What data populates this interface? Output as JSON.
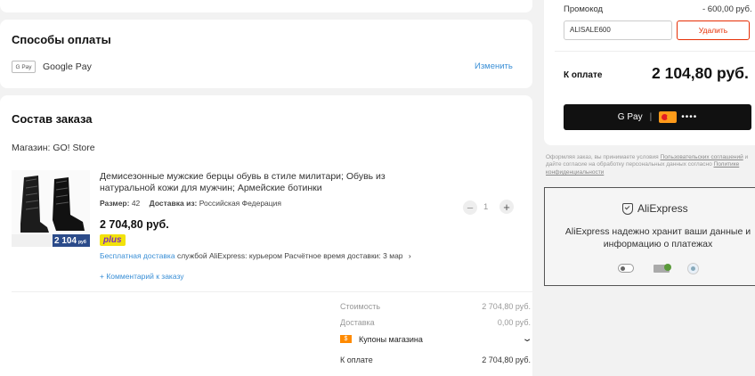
{
  "payment": {
    "title": "Способы оплаты",
    "method_badge": "G Pay",
    "method_name": "Google Pay",
    "change_label": "Изменить"
  },
  "order": {
    "title": "Состав заказа",
    "store": "Магазин: GO! Store",
    "item": {
      "title_line1": "Демисезонные мужские берцы обувь в стиле милитари; Обувь из",
      "title_line2": "натуральной кожи для мужчин; Армейские ботинки",
      "size_label": "Размер:",
      "size_value": "42",
      "ship_from_label": "Доставка из:",
      "ship_from_value": "Российская Федерация",
      "price": "2 704,80 руб.",
      "plus_badge": "plus",
      "qty": "1",
      "thumb_price": "2 104",
      "thumb_price_suffix": "руб",
      "delivery_free": "Бесплатная доставка",
      "delivery_rest": "службой AliExpress: курьером  Расчётное время доставки: 3 мар",
      "comment_link": "+ Комментарий к заказу"
    },
    "summary": {
      "cost_label": "Стоимость",
      "cost_value": "2 704,80 руб.",
      "delivery_label": "Доставка",
      "delivery_value": "0,00 руб.",
      "coupons_badge": "$",
      "coupons_label": "Купоны магазина",
      "total_label": "К оплате",
      "total_value": "2 704,80 руб."
    }
  },
  "checkout": {
    "promo_label": "Промокод",
    "promo_value": "- 600,00 руб.",
    "promo_code": "ALISALE600",
    "remove_label": "Удалить",
    "total_label": "К оплате",
    "total_value": "2 104,80 руб.",
    "gpay_text": "G Pay",
    "card_mask": "••••",
    "consent_1": "Оформляя заказ, вы принимаете условия",
    "consent_link_1": "Пользовательских соглашений",
    "consent_2": "и дайте согласие на обработку персональных данных согласно",
    "consent_link_2": "Политике конфиденциальности",
    "security_brand": "AliExpress",
    "security_text": "AliExpress надежно хранит ваши данные и информацию о платежах"
  },
  "colors": {
    "accent_red": "#e62e04",
    "link_blue": "#3a8fd6",
    "plus_yellow": "#f2e20a",
    "plus_purple": "#7b2cbf",
    "black_button": "#111111",
    "coupon_orange": "#ff8a00"
  }
}
